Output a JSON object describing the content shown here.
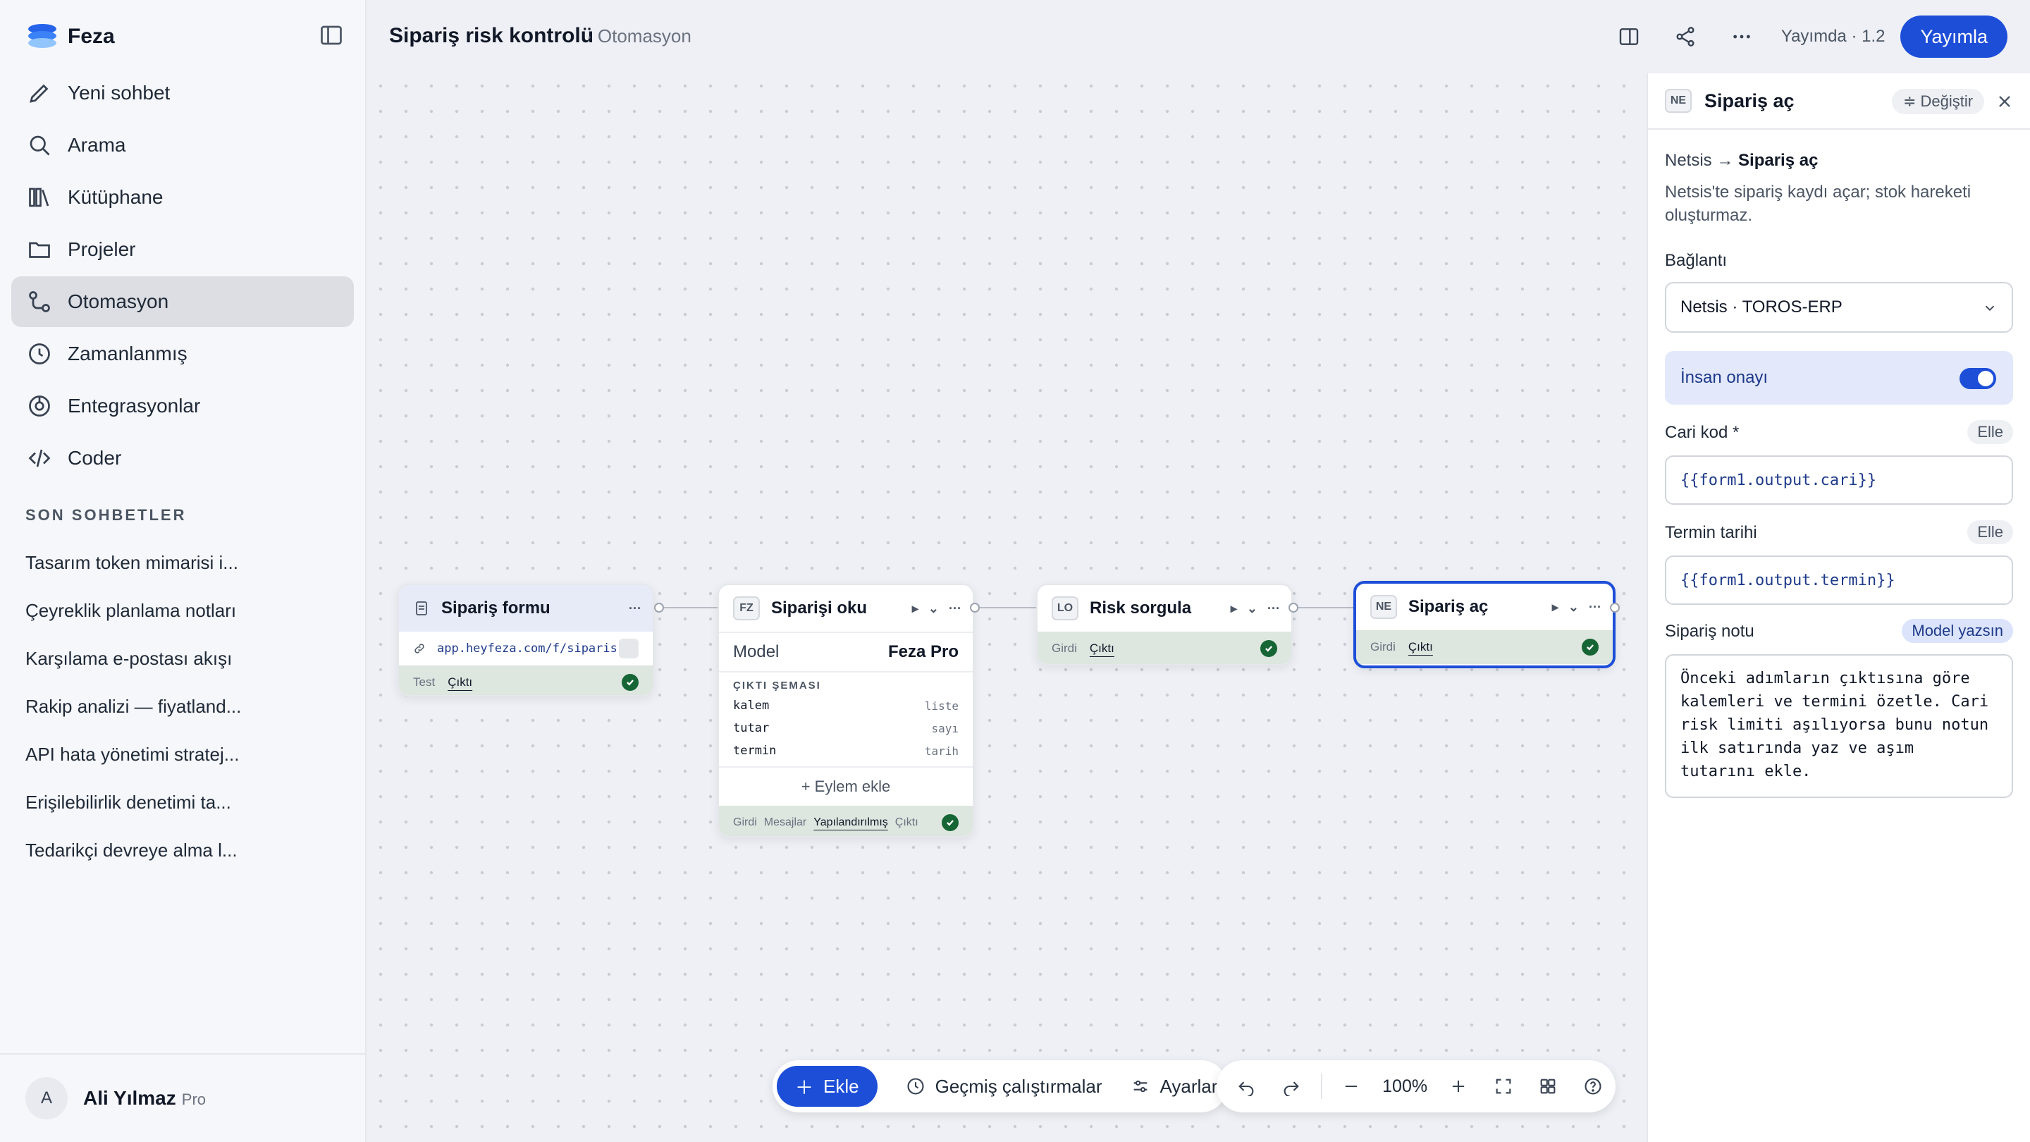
{
  "app": {
    "name": "Feza"
  },
  "sidebar": {
    "items": [
      {
        "label": "Yeni sohbet",
        "icon": "pencil-icon"
      },
      {
        "label": "Arama",
        "icon": "search-icon"
      },
      {
        "label": "Kütüphane",
        "icon": "library-icon"
      },
      {
        "label": "Projeler",
        "icon": "folder-icon"
      },
      {
        "label": "Otomasyon",
        "icon": "workflow-icon",
        "active": true
      },
      {
        "label": "Zamanlanmış",
        "icon": "clock-icon"
      },
      {
        "label": "Entegrasyonlar",
        "icon": "integration-icon"
      },
      {
        "label": "Coder",
        "icon": "code-icon"
      }
    ],
    "recent_title": "SON SOHBETLER",
    "recent": [
      "Tasarım token mimarisi i...",
      "Çeyreklik planlama notları",
      "Karşılama e-postası akışı",
      "Rakip analizi — fiyatland...",
      "API hata yönetimi stratej...",
      "Erişilebilirlik denetimi ta...",
      "Tedarikçi devreye alma l..."
    ],
    "user": {
      "initial": "A",
      "name": "Ali Yılmaz",
      "plan": "Pro"
    }
  },
  "header": {
    "title": "Sipariş risk kontrolü",
    "subtitle": "· Otomasyon",
    "status": "Yayımda · 1.2",
    "publish_label": "Yayımla"
  },
  "nodes": {
    "form": {
      "title": "Sipariş formu",
      "url": "app.heyfeza.com/f/siparis",
      "foot_left": "Test",
      "foot_tab": "Çıktı"
    },
    "read": {
      "badge": "FZ",
      "title": "Siparişi oku",
      "model_label": "Model",
      "model_value": "Feza Pro",
      "schema_title": "ÇIKTI ŞEMASI",
      "schema": [
        {
          "name": "kalem",
          "type": "liste"
        },
        {
          "name": "tutar",
          "type": "sayı"
        },
        {
          "name": "termin",
          "type": "tarih"
        }
      ],
      "add_action": "+ Eylem ekle",
      "foot": [
        "Girdi",
        "Mesajlar",
        "Yapılandırılmış",
        "Çıktı"
      ]
    },
    "risk": {
      "badge": "LO",
      "title": "Risk sorgula",
      "foot_left": "Girdi",
      "foot_tab": "Çıktı"
    },
    "order": {
      "badge": "NE",
      "title": "Sipariş aç",
      "foot_left": "Girdi",
      "foot_tab": "Çıktı"
    }
  },
  "toolbar": {
    "add_label": "Ekle",
    "history_label": "Geçmiş çalıştırmalar",
    "settings_label": "Ayarlar",
    "zoom": "100%"
  },
  "panel": {
    "badge": "NE",
    "title": "Sipariş aç",
    "change_label": "≑ Değiştir",
    "crumb_source": "Netsis",
    "crumb_arrow": "→",
    "crumb_target": "Sipariş aç",
    "description": "Netsis'te sipariş kaydı açar; stok hareketi oluşturmaz.",
    "connection_label": "Bağlantı",
    "connection_value": "Netsis · TOROS-ERP",
    "approval_label": "İnsan onayı",
    "approval_on": true,
    "cari_label": "Cari kod *",
    "cari_mode": "Elle",
    "cari_value": "{{form1.output.cari}}",
    "termin_label": "Termin tarihi",
    "termin_mode": "Elle",
    "termin_value": "{{form1.output.termin}}",
    "note_label": "Sipariş notu",
    "note_mode": "Model yazsın",
    "note_value": "Önceki adımların çıktısına göre kalemleri ve termini özetle. Cari risk limiti aşılıyorsa bunu notun ilk satırında yaz ve aşım tutarını ekle."
  },
  "colors": {
    "accent": "#1d4ed8",
    "success": "#166534",
    "sidebar_bg": "#f6f7fa",
    "canvas_bg": "#eef0f5"
  }
}
